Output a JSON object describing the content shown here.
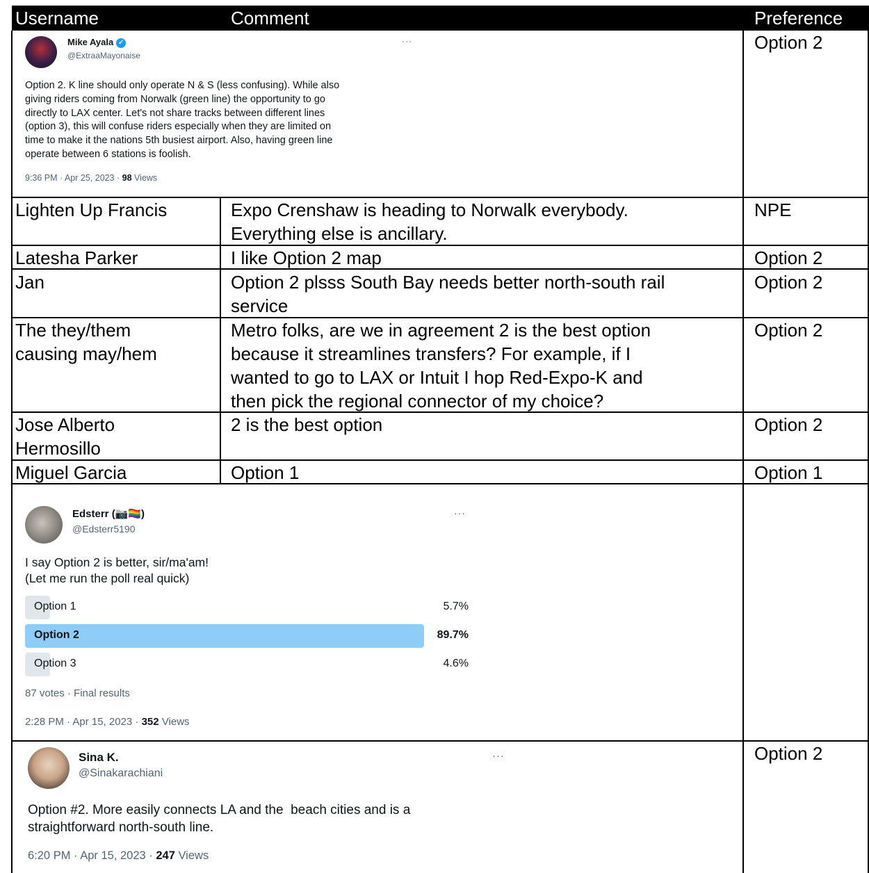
{
  "header": {
    "username": "Username",
    "comment": "Comment",
    "preference": "Preference"
  },
  "rows": [
    {
      "type": "tweet",
      "tweet": {
        "name": "Mike Ayala",
        "handle": "@ExtraaMayonaise",
        "more": "···",
        "body": "Option 2. K line should only operate N & S (less confusing). While also\ngiving riders coming from Norwalk (green line) the opportunity to go\ndirectly to LAX center. Let's not share tracks between different lines\n(option 3), this will confuse riders especially when they are limited on\ntime to make it the nations 5th busiest airport. Also, having green line\noperate between 6 stations is foolish.",
        "time": "9:36 PM · Apr 25, 2023 · ",
        "views_count": "98",
        "views_label": " Views"
      },
      "preference": "Option 2"
    },
    {
      "type": "text",
      "username": "Lighten Up Francis",
      "comment": "Expo Crenshaw is heading to Norwalk everybody.\nEverything else is ancillary.",
      "preference": "NPE"
    },
    {
      "type": "text",
      "username": "Latesha Parker",
      "comment": "I like Option 2 map",
      "preference": "Option 2"
    },
    {
      "type": "text",
      "username": "Jan",
      "comment": "Option 2 plsss South Bay needs better north-south rail\nservice",
      "preference": "Option 2"
    },
    {
      "type": "text",
      "username": "The they/them\ncausing may/hem",
      "comment": "Metro folks, are we in agreement 2 is the best option\nbecause it streamlines transfers? For example, if I\nwanted to go to LAX or Intuit I hop Red-Expo-K and\nthen pick the regional connector of my choice?",
      "preference": "Option 2"
    },
    {
      "type": "text",
      "username": "Jose Alberto\nHermosillo",
      "comment": "2 is the best option",
      "preference": "Option 2"
    },
    {
      "type": "text",
      "username": "Miguel Garcia",
      "comment": "Option 1",
      "preference": "Option 1"
    },
    {
      "type": "tweet-poll",
      "tweet": {
        "name": "Edsterr (📷🏳️‍🌈)",
        "handle": "@Edsterr5190",
        "more": "···",
        "body": "I say Option 2 is better, sir/ma'am!\n(Let me run the poll real quick)",
        "poll": [
          {
            "label": "Option 1",
            "percent_text": "5.7%",
            "percent": 5.7,
            "winner": false
          },
          {
            "label": "Option 2",
            "percent_text": "89.7%",
            "percent": 89.7,
            "winner": true
          },
          {
            "label": "Option 3",
            "percent_text": "4.6%",
            "percent": 4.6,
            "winner": false
          }
        ],
        "poll_footer": "87 votes · Final results",
        "time": "2:28 PM · Apr 15, 2023 · ",
        "views_count": "352",
        "views_label": " Views"
      },
      "preference": ""
    },
    {
      "type": "tweet",
      "tweet": {
        "name": "Sina K.",
        "handle": "@Sinakarachiani",
        "more": "···",
        "body": "Option #2. More easily connects LA and the  beach cities and is a\nstraightforward north-south line.",
        "time": "6:20 PM · Apr 15, 2023 · ",
        "views_count": "247",
        "views_label": " Views"
      },
      "preference": "Option 2"
    }
  ],
  "colors": {
    "poll_winner": "#8ecdf8",
    "poll_other": "#e1e6ea",
    "muted_text": "#536471"
  }
}
